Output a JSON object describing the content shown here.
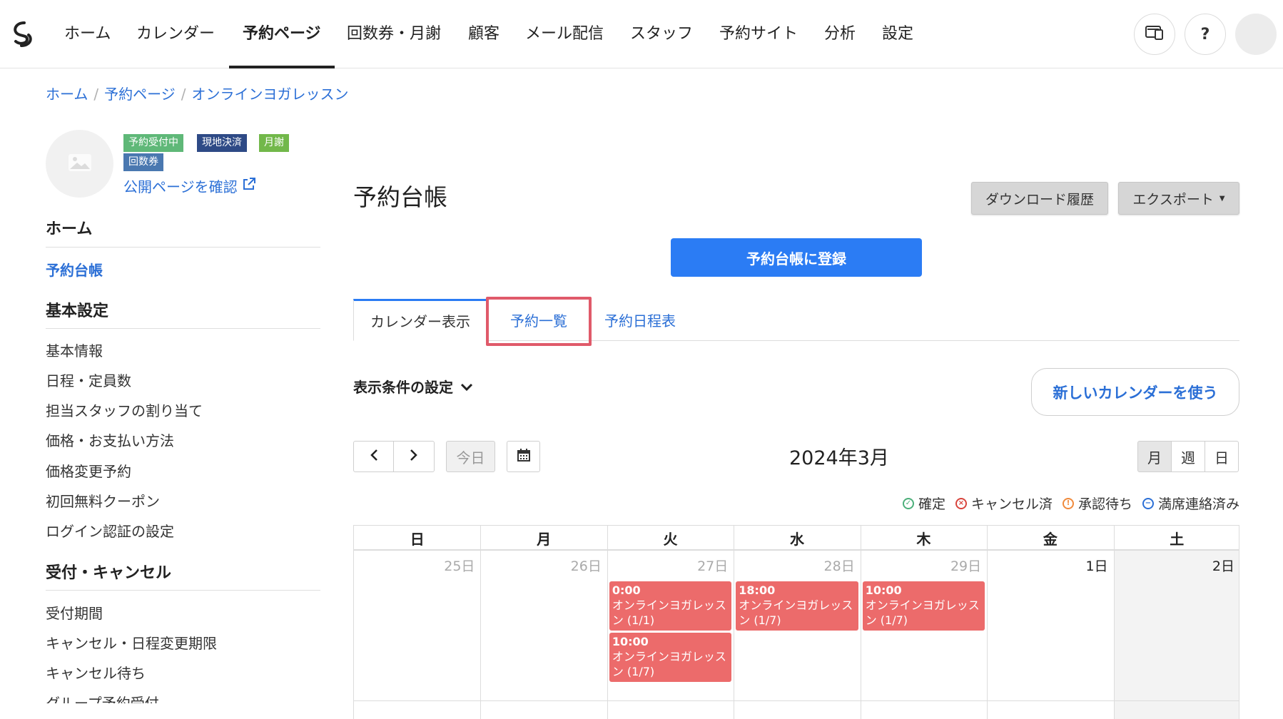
{
  "nav": {
    "items": [
      "ホーム",
      "カレンダー",
      "予約ページ",
      "回数券・月謝",
      "顧客",
      "メール配信",
      "スタッフ",
      "予約サイト",
      "分析",
      "設定"
    ],
    "active_index": 2,
    "help_label": "?"
  },
  "breadcrumb": [
    "ホーム",
    "予約ページ",
    "オンラインヨガレッスン"
  ],
  "badges": [
    {
      "label": "予約受付中",
      "color": "#5fb878"
    },
    {
      "label": "現地決済",
      "color": "#2e4a86"
    },
    {
      "label": "月謝",
      "color": "#72b84a"
    },
    {
      "label": "回数券",
      "color": "#4a78b0"
    }
  ],
  "public_link": "公開ページを確認",
  "sidebar": {
    "sections": [
      {
        "title": "ホーム",
        "items": [
          "予約台帳"
        ]
      },
      {
        "title": "基本設定",
        "items": [
          "基本情報",
          "日程・定員数",
          "担当スタッフの割り当て",
          "価格・お支払い方法",
          "価格変更予約",
          "初回無料クーポン",
          "ログイン認証の設定"
        ]
      },
      {
        "title": "受付・キャンセル",
        "items": [
          "受付期間",
          "キャンセル・日程変更期限",
          "キャンセル待ち",
          "グループ予約受付"
        ]
      }
    ],
    "active_item": "予約台帳"
  },
  "main": {
    "title": "予約台帳",
    "download_history": "ダウンロード履歴",
    "export": "エクスポート",
    "register_button": "予約台帳に登録",
    "tabs": [
      "カレンダー表示",
      "予約一覧",
      "予約日程表"
    ],
    "active_tab": 0,
    "highlighted_tab": 1,
    "filter_label": "表示条件の設定",
    "new_calendar_button": "新しいカレンダーを使う"
  },
  "calendar": {
    "today_label": "今日",
    "month_title": "2024年3月",
    "views": [
      "月",
      "週",
      "日"
    ],
    "active_view": 0,
    "legend": [
      {
        "label": "確定",
        "color": "#4caf7a",
        "icon": "check-circle-icon"
      },
      {
        "label": "キャンセル済",
        "color": "#d8443c",
        "icon": "x-circle-icon"
      },
      {
        "label": "承認待ち",
        "color": "#f08a3c",
        "icon": "exclamation-circle-icon"
      },
      {
        "label": "満席連絡済み",
        "color": "#2b6fd6",
        "icon": "minus-circle-icon"
      }
    ],
    "weekdays": [
      "日",
      "月",
      "火",
      "水",
      "木",
      "金",
      "土"
    ],
    "first_week_days": [
      "25日",
      "26日",
      "27日",
      "28日",
      "29日",
      "1日",
      "2日"
    ],
    "first_current_month_index": 5,
    "events": [
      {
        "day_index": 2,
        "slot": 0,
        "time": "0:00",
        "name": "オンラインヨガレッスン (1/1)"
      },
      {
        "day_index": 2,
        "slot": 1,
        "time": "10:00",
        "name": "オンラインヨガレッスン (1/7)"
      },
      {
        "day_index": 3,
        "slot": 0,
        "time": "18:00",
        "name": "オンラインヨガレッスン (1/7)"
      },
      {
        "day_index": 4,
        "slot": 0,
        "time": "10:00",
        "name": "オンラインヨガレッスン (1/7)"
      }
    ]
  }
}
